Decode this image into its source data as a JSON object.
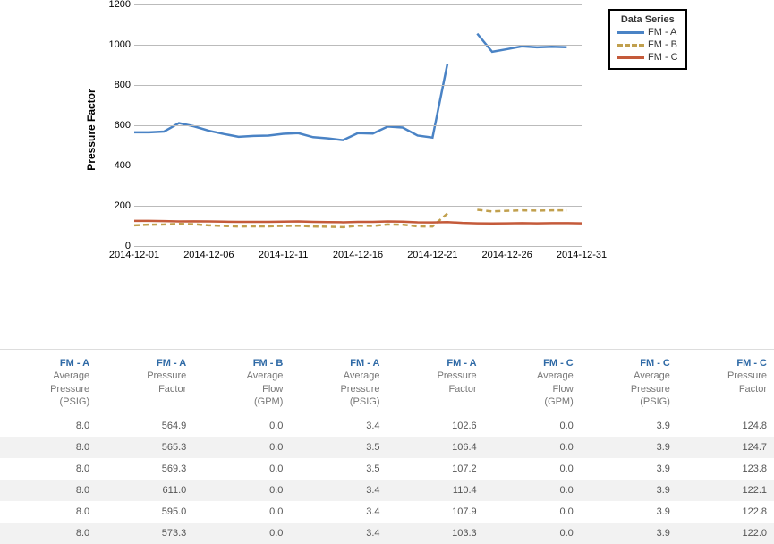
{
  "chart_data": {
    "type": "line",
    "ylabel": "Pressure Factor",
    "xlabel": "",
    "ylim": [
      0,
      1200
    ],
    "y_ticks": [
      0,
      200,
      400,
      600,
      800,
      1000,
      1200
    ],
    "x_tick_labels": [
      "2014-12-01",
      "2014-12-06",
      "2014-12-11",
      "2014-12-16",
      "2014-12-21",
      "2014-12-26",
      "2014-12-31"
    ],
    "x_tick_positions": [
      1,
      6,
      11,
      16,
      21,
      26,
      31
    ],
    "x_range": [
      1,
      31
    ],
    "legend_title": "Data Series",
    "series": [
      {
        "name": "FM - A",
        "color": "#4a83c5",
        "style": "solid",
        "x": [
          1,
          2,
          3,
          4,
          5,
          6,
          7,
          8,
          9,
          10,
          11,
          12,
          13,
          14,
          15,
          16,
          17,
          18,
          19,
          20,
          21,
          22
        ],
        "values": [
          565,
          565,
          569,
          611,
          595,
          573,
          557,
          543,
          547,
          549,
          558,
          561,
          541,
          535,
          526,
          561,
          559,
          594,
          589,
          549,
          539,
          905
        ]
      },
      {
        "name": "FM - A (seg2)",
        "legend_hidden": true,
        "color": "#4a83c5",
        "style": "solid",
        "x": [
          24,
          25,
          26,
          27,
          28,
          29,
          30
        ],
        "values": [
          1055,
          965,
          978,
          992,
          987,
          990,
          988
        ]
      },
      {
        "name": "FM - B",
        "color": "#c1a04e",
        "style": "dashed",
        "x": [
          1,
          2,
          3,
          4,
          5,
          6,
          7,
          8,
          9,
          10,
          11,
          12,
          13,
          14,
          15,
          16,
          17,
          18,
          19,
          20,
          21,
          22
        ],
        "values": [
          103,
          106,
          107,
          110,
          108,
          103,
          100,
          97,
          98,
          98,
          100,
          101,
          97,
          96,
          94,
          101,
          100,
          107,
          106,
          98,
          97,
          162
        ]
      },
      {
        "name": "FM - B (seg2)",
        "legend_hidden": true,
        "color": "#c1a04e",
        "style": "dashed",
        "x": [
          24,
          25,
          26,
          27,
          28,
          29,
          30
        ],
        "values": [
          180,
          172,
          175,
          177,
          176,
          177,
          177
        ]
      },
      {
        "name": "FM - C",
        "color": "#c45a3a",
        "style": "solid",
        "x": [
          1,
          2,
          3,
          4,
          5,
          6,
          7,
          8,
          9,
          10,
          11,
          12,
          13,
          14,
          15,
          16,
          17,
          18,
          19,
          20,
          21,
          22,
          23,
          24,
          25,
          26,
          27,
          28,
          29,
          30,
          31
        ],
        "values": [
          125,
          125,
          124,
          122,
          123,
          122,
          121,
          120,
          120,
          120,
          121,
          122,
          120,
          119,
          118,
          120,
          120,
          122,
          121,
          118,
          117,
          119,
          115,
          113,
          112,
          113,
          114,
          113,
          114,
          114,
          113
        ]
      }
    ]
  },
  "table": {
    "columns": [
      {
        "top": "FM - A",
        "sub": "Average\nPressure\n(PSIG)"
      },
      {
        "top": "FM - A",
        "sub": "Pressure\nFactor"
      },
      {
        "top": "FM - B",
        "sub": "Average\nFlow\n(GPM)"
      },
      {
        "top": "FM - A",
        "sub": "Average\nPressure\n(PSIG)"
      },
      {
        "top": "FM - A",
        "sub": "Pressure\nFactor"
      },
      {
        "top": "FM - C",
        "sub": "Average\nFlow\n(GPM)"
      },
      {
        "top": "FM - C",
        "sub": "Average\nPressure\n(PSIG)"
      },
      {
        "top": "FM - C",
        "sub": "Pressure\nFactor"
      }
    ],
    "rows": [
      [
        "8.0",
        "564.9",
        "0.0",
        "3.4",
        "102.6",
        "0.0",
        "3.9",
        "124.8"
      ],
      [
        "8.0",
        "565.3",
        "0.0",
        "3.5",
        "106.4",
        "0.0",
        "3.9",
        "124.7"
      ],
      [
        "8.0",
        "569.3",
        "0.0",
        "3.5",
        "107.2",
        "0.0",
        "3.9",
        "123.8"
      ],
      [
        "8.0",
        "611.0",
        "0.0",
        "3.4",
        "110.4",
        "0.0",
        "3.9",
        "122.1"
      ],
      [
        "8.0",
        "595.0",
        "0.0",
        "3.4",
        "107.9",
        "0.0",
        "3.9",
        "122.8"
      ],
      [
        "8.0",
        "573.3",
        "0.0",
        "3.4",
        "103.3",
        "0.0",
        "3.9",
        "122.0"
      ]
    ]
  }
}
